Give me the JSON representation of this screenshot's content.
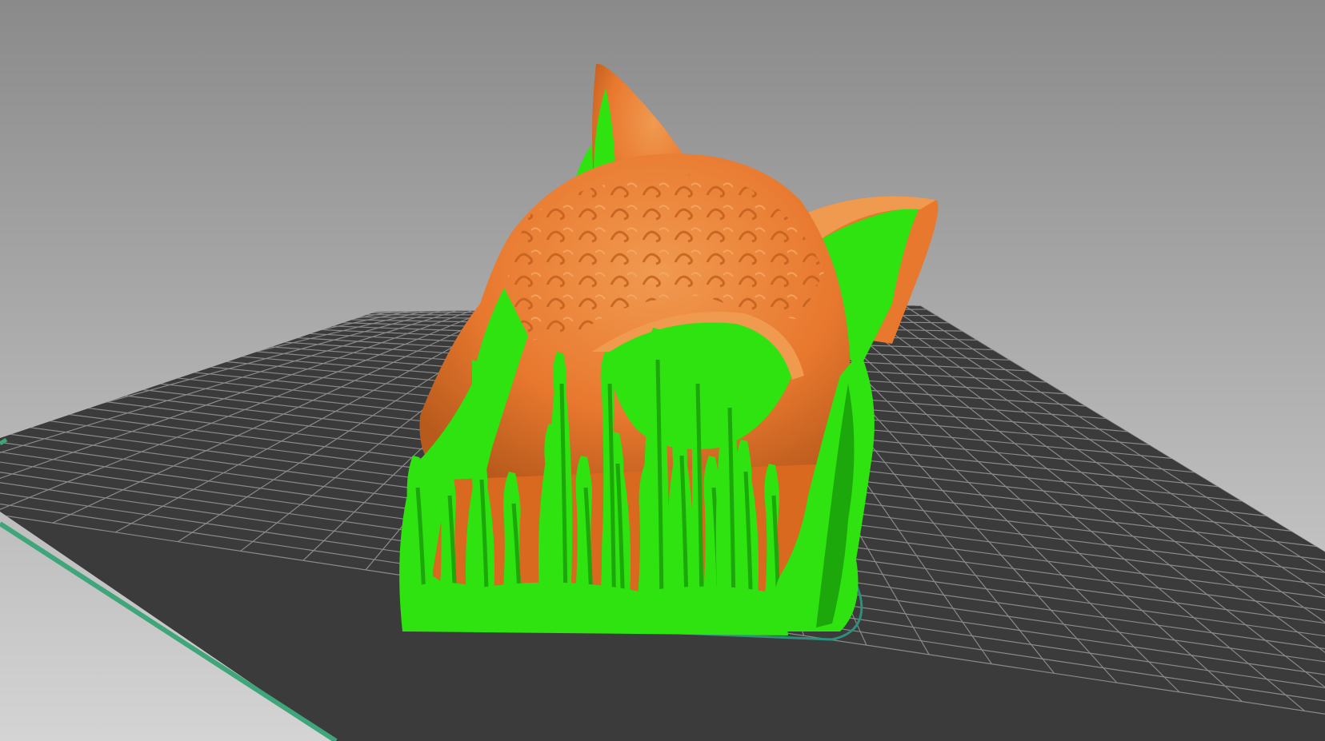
{
  "viewport": {
    "view": "slicer-3d-preview",
    "background_top_color": "#8a8a8a",
    "background_bottom_color": "#d4d4d4"
  },
  "build_plate": {
    "plate_color": "#3b3b3b",
    "grid_color": "#8a8a8a",
    "edge_color": "#3fa57a"
  },
  "model": {
    "icon": "cat-skull-model",
    "part_color": "#e8782e",
    "part_shadow_color": "#b85a1c",
    "support_color": "#2ee30f",
    "support_shadow_color": "#1ca80a",
    "skirt_color": "#2f8f7a"
  }
}
